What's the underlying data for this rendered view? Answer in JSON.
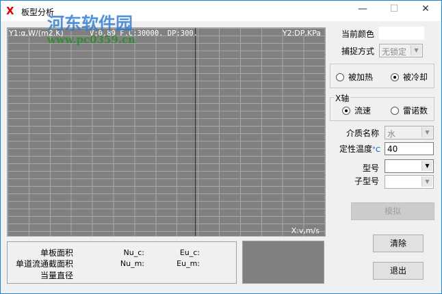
{
  "window": {
    "title": "板型分析",
    "logo": "X",
    "minimize": "—",
    "maximize": "☐",
    "close": "✕"
  },
  "watermark": {
    "name": "河东软件园",
    "url": "www.pc0359.cn"
  },
  "chart": {
    "y1_label": "Y1:α,W/(m2.K)",
    "params": "V:0.89 F.C:30000. DP:300.",
    "y2_label": "Y2:DP,KPa",
    "x_label": "X:v,m/s"
  },
  "panel": {
    "current_color_label": "当前颜色",
    "capture_label": "捕捉方式",
    "capture_value": "无锁定",
    "heat_mode": {
      "heated": "被加热",
      "cooled": "被冷却",
      "selected": "cooled"
    },
    "x_axis": {
      "title": "X轴",
      "flow": "流速",
      "reynolds": "雷诺数",
      "selected": "flow"
    },
    "medium_label": "介质名称",
    "medium_value": "水",
    "temp_label": "定性温度",
    "temp_unit": "°C",
    "temp_value": "40",
    "model_label": "型号",
    "model_value": "",
    "submodel_label": "子型号",
    "submodel_value": "",
    "simulate": "模拟",
    "clear": "清除",
    "exit": "退出"
  },
  "results": {
    "plate_area": "单板面积",
    "channel_area": "单道流通截面积",
    "eq_diameter": "当量直径",
    "nu_c": "Nu_c:",
    "nu_m": "Nu_m:",
    "eu_c": "Eu_c:",
    "eu_m": "Eu_m:"
  }
}
